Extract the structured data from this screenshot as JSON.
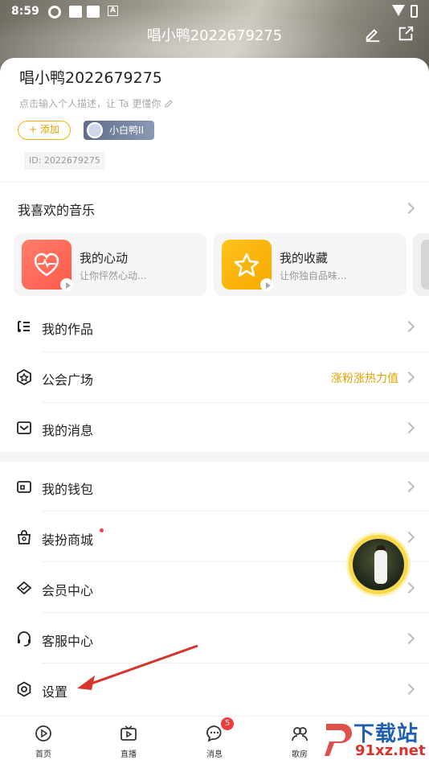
{
  "status_bar": {
    "time": "8:59"
  },
  "header": {
    "title": "唱小鸭2022679275"
  },
  "profile": {
    "username": "唱小鸭2022679275",
    "description": "点击输入个人描述，让 Ta 更懂你",
    "add_label": "+ 添加",
    "badge_label": "小白鸭II",
    "id_text": "ID: 2022679275"
  },
  "favorites": {
    "title": "我喜欢的音乐",
    "cards": [
      {
        "title": "我的心动",
        "subtitle": "让你怦然心动...",
        "color": "#ff6b5a",
        "icon": "heart-pulse-icon"
      },
      {
        "title": "我的收藏",
        "subtitle": "让你独自品味...",
        "color": "#f5b400",
        "icon": "star-icon"
      }
    ]
  },
  "menu_group_1": [
    {
      "label": "我的作品",
      "icon": "music-list-icon",
      "extra": ""
    },
    {
      "label": "公会广场",
      "icon": "guild-icon",
      "extra": "涨粉涨热力值"
    },
    {
      "label": "我的消息",
      "icon": "mail-icon",
      "extra": ""
    }
  ],
  "menu_group_2": [
    {
      "label": "我的钱包",
      "icon": "wallet-icon"
    },
    {
      "label": "装扮商城",
      "icon": "shop-bag-icon"
    },
    {
      "label": "会员中心",
      "icon": "vip-diamond-icon"
    },
    {
      "label": "客服中心",
      "icon": "headset-icon"
    },
    {
      "label": "设置",
      "icon": "settings-gear-icon"
    }
  ],
  "tabbar": [
    {
      "label": "首页",
      "icon": "home-play-icon"
    },
    {
      "label": "直播",
      "icon": "tv-icon"
    },
    {
      "label": "消息",
      "icon": "chat-bubble-icon",
      "badge": "5"
    },
    {
      "label": "歌房",
      "icon": "room-icon"
    }
  ],
  "watermark": {
    "big": "下载站",
    "small": "91xz.net"
  },
  "colors": {
    "accent": "#f5b400",
    "arrow": "#d8322c"
  }
}
